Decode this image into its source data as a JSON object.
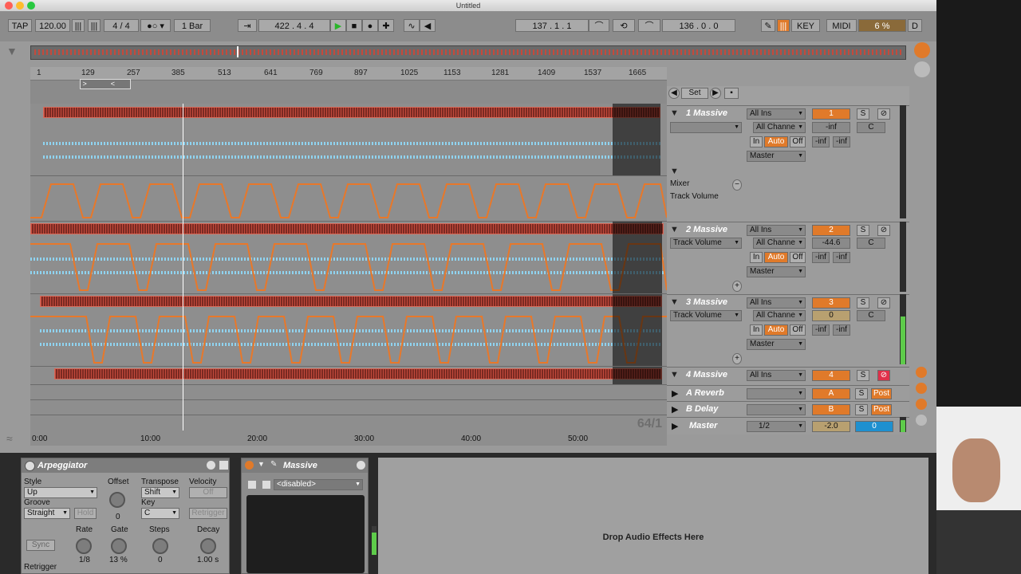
{
  "window": {
    "title": "Untitled"
  },
  "toolbar": {
    "tap": "TAP",
    "tempo": "120.00",
    "signature": "4  /  4",
    "quantize": "1 Bar",
    "position": "422 .  4 .  4",
    "loop_start": "137 .  1 .  1",
    "loop_length": "136 .  0 .  0",
    "key": "KEY",
    "midi": "MIDI",
    "cpu": "6 %",
    "d": "D"
  },
  "ruler": {
    "labels": [
      "1",
      "129",
      "257",
      "385",
      "513",
      "641",
      "769",
      "897",
      "1025",
      "1153",
      "1281",
      "1409",
      "1537",
      "1665"
    ]
  },
  "timeline": {
    "labels": [
      "0:00",
      "10:00",
      "20:00",
      "30:00",
      "40:00",
      "50:00"
    ],
    "zoom": "64/1"
  },
  "setbar": {
    "set_label": "Set"
  },
  "tracks": [
    {
      "name": "1 Massive",
      "input": "All Ins",
      "channel": "All Channe",
      "in": "In",
      "auto": "Auto",
      "off": "Off",
      "output": "Master",
      "number": "1",
      "volume": "-inf",
      "pan": "C",
      "meter_l": "-inf",
      "meter_r": "-inf",
      "solo": "S",
      "automation_device": "Mixer",
      "automation_param": "Track Volume"
    },
    {
      "name": "2 Massive",
      "input": "All Ins",
      "channel": "All Channe",
      "in": "In",
      "auto": "Auto",
      "off": "Off",
      "output": "Master",
      "number": "2",
      "volume": "-44.6",
      "pan": "C",
      "meter_l": "-inf",
      "meter_r": "-inf",
      "solo": "S",
      "param": "Track Volume"
    },
    {
      "name": "3 Massive",
      "input": "All Ins",
      "channel": "All Channe",
      "in": "In",
      "auto": "Auto",
      "off": "Off",
      "output": "Master",
      "number": "3",
      "volume": "0",
      "pan": "C",
      "meter_l": "-inf",
      "meter_r": "-inf",
      "solo": "S",
      "param": "Track Volume"
    },
    {
      "name": "4 Massive",
      "input": "All Ins",
      "number": "4",
      "solo": "S"
    }
  ],
  "returns": [
    {
      "name": "A Reverb",
      "letter": "A",
      "solo": "S",
      "post": "Post"
    },
    {
      "name": "B Delay",
      "letter": "B",
      "solo": "S",
      "post": "Post"
    }
  ],
  "master": {
    "name": "Master",
    "cue": "1/2",
    "volume": "-2.0",
    "pan": "0"
  },
  "arpeggiator": {
    "title": "Arpeggiator",
    "style_label": "Style",
    "style_value": "Up",
    "groove_label": "Groove",
    "groove_value": "Straight",
    "hold": "Hold",
    "offset_label": "Offset",
    "offset_value": "0",
    "transpose_label": "Transpose",
    "transpose_value": "Shift",
    "key_label": "Key",
    "key_value": "C",
    "velocity_label": "Velocity",
    "velocity_value": "Off",
    "retrigger_btn": "Retrigger",
    "sync": "Sync",
    "rate_label": "Rate",
    "rate_value": "1/8",
    "gate_label": "Gate",
    "gate_value": "13 %",
    "steps_label": "Steps",
    "steps_value": "0",
    "decay_label": "Decay",
    "decay_value": "1.00 s",
    "retrigger_label": "Retrigger"
  },
  "massive": {
    "title": "Massive",
    "preset": "<disabled>"
  },
  "drop_zone": {
    "text": "Drop Audio Effects Here"
  }
}
